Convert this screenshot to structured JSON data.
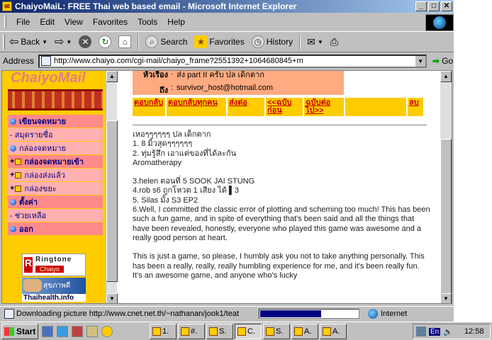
{
  "window": {
    "title": "ChaiyoMaiL: FREE Thai web based email - Microsoft Internet Explorer",
    "controls": {
      "minimize": "_",
      "maximize": "□",
      "close": "✕"
    }
  },
  "menu": [
    "File",
    "Edit",
    "View",
    "Favorites",
    "Tools",
    "Help"
  ],
  "toolbar": {
    "back": "Back",
    "search": "Search",
    "favorites": "Favorites",
    "history": "History"
  },
  "address": {
    "label": "Address",
    "url": "http://www.chaiyo.com/cgi-mail/chaiyo_frame?2551392+1064680845+m",
    "go": "Go"
  },
  "sidebar": {
    "logo": "ChaiyoMail",
    "items": [
      {
        "label": "เขียนจดหมาย",
        "style": "head",
        "marker": "bullet"
      },
      {
        "label": "- สมุดรายชื่อ",
        "style": "sub",
        "marker": ""
      },
      {
        "label": "กล่องจดหมาย",
        "style": "sub",
        "marker": "bullet"
      },
      {
        "label": "กล่องจดหมายเข้า",
        "style": "head",
        "marker": "box"
      },
      {
        "label": "กล่องส่งแล้ว",
        "style": "sub",
        "marker": "box"
      },
      {
        "label": "กล่องขยะ",
        "style": "sub",
        "marker": "box"
      },
      {
        "label": "ตั้งค่า",
        "style": "head",
        "marker": "bullet"
      },
      {
        "label": "- ช่วยเหลือ",
        "style": "sub",
        "marker": ""
      },
      {
        "label": "ออก",
        "style": "head",
        "marker": "bullet"
      }
    ],
    "ad_ringtone": {
      "title": "Ringtone",
      "sub": "Chaiyo",
      "letter": "R"
    },
    "ad_health": {
      "thai": "สุขภาพดี",
      "url": "Thaihealth.info"
    }
  },
  "message": {
    "subject_label": "หัวเรื่อง",
    "subject": "ส่ง part II ครับ ปล เด็กตาก",
    "to_label": "ถึง",
    "to": "survivor_host@hotmail.com",
    "actions": [
      "ตอบกลับ",
      "ตอบกลับทุกคน",
      "ส่งต่อ",
      "<<ฉบับก่อน",
      "ฉบับต่อไป>>",
      "ลบ"
    ],
    "body": [
      "เหอๆๆๆๆๆๆ ปล เด็กตาก",
      "1. 8 มิ้วสุดๆๆๆๆๆๆ",
      "2. ทุ่มรู้สึก เอาแต่ของที่ได้ละกัน",
      "Aromatherapy",
      "",
      "3.helen ตอนที่ 5 SOOK JAI STUNG",
      "4.rob s6 ถูกโหวต 1 เสียง ได้ ▌3",
      "5. Silas มั้ง S3 EP2",
      "6.Well, I committed the classic error of plotting and scheming too much! This has been such a fun game, and in spite of everything that's been said and all the things that have been revealed, honestly, everyone who played this game was awesome and a really good person at heart.",
      "",
      "This is just a game, so please, I humbly ask you not to take anything personally. This has been a really, really, really humbling experience for me, and it's been really fun. It's an awesome game, and anyone who's lucky"
    ]
  },
  "status": {
    "text": "Downloading picture http://www.cnet.net.th/~nathanan/jook1/teat",
    "progress": 0.62,
    "zone": "Internet"
  },
  "taskbar": {
    "start": "Start",
    "tasks": [
      "1.",
      "#.",
      "S.",
      "C.",
      "S.",
      "A.",
      "A."
    ],
    "active_index": 3,
    "lang": "En",
    "clock": "12:58"
  }
}
